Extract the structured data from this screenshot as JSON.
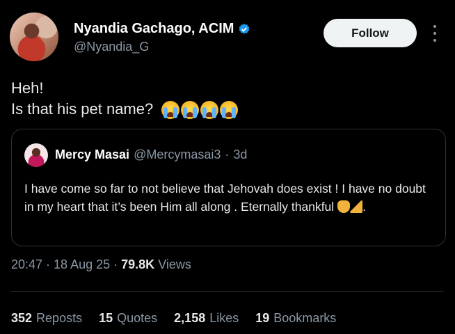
{
  "author": {
    "display_name": "Nyandia Gachago, ACIM",
    "handle": "@Nyandia_G",
    "verified": true
  },
  "follow_label": "Follow",
  "tweet": {
    "line1": "Heh!",
    "line2": "Is that his pet name?"
  },
  "quote": {
    "name": "Mercy Masai",
    "handle": "@Mercymasai3",
    "separator": "·",
    "time": "3d",
    "text": "I have come so far to not believe that Jehovah does exist ! I have no doubt in my heart  that it’s been Him all along . Eternally thankful",
    "text_end": "."
  },
  "meta": {
    "time": "20:47",
    "sep1": "·",
    "date": "18 Aug 25",
    "sep2": "·",
    "views_count": "79.8K",
    "views_label": "Views"
  },
  "stats": [
    {
      "count": "352",
      "label": "Reposts"
    },
    {
      "count": "15",
      "label": "Quotes"
    },
    {
      "count": "2,158",
      "label": "Likes"
    },
    {
      "count": "19",
      "label": "Bookmarks"
    }
  ],
  "colors": {
    "background": "#000000",
    "verified_blue": "#1d9bf0",
    "muted_text": "#8b98a5"
  }
}
